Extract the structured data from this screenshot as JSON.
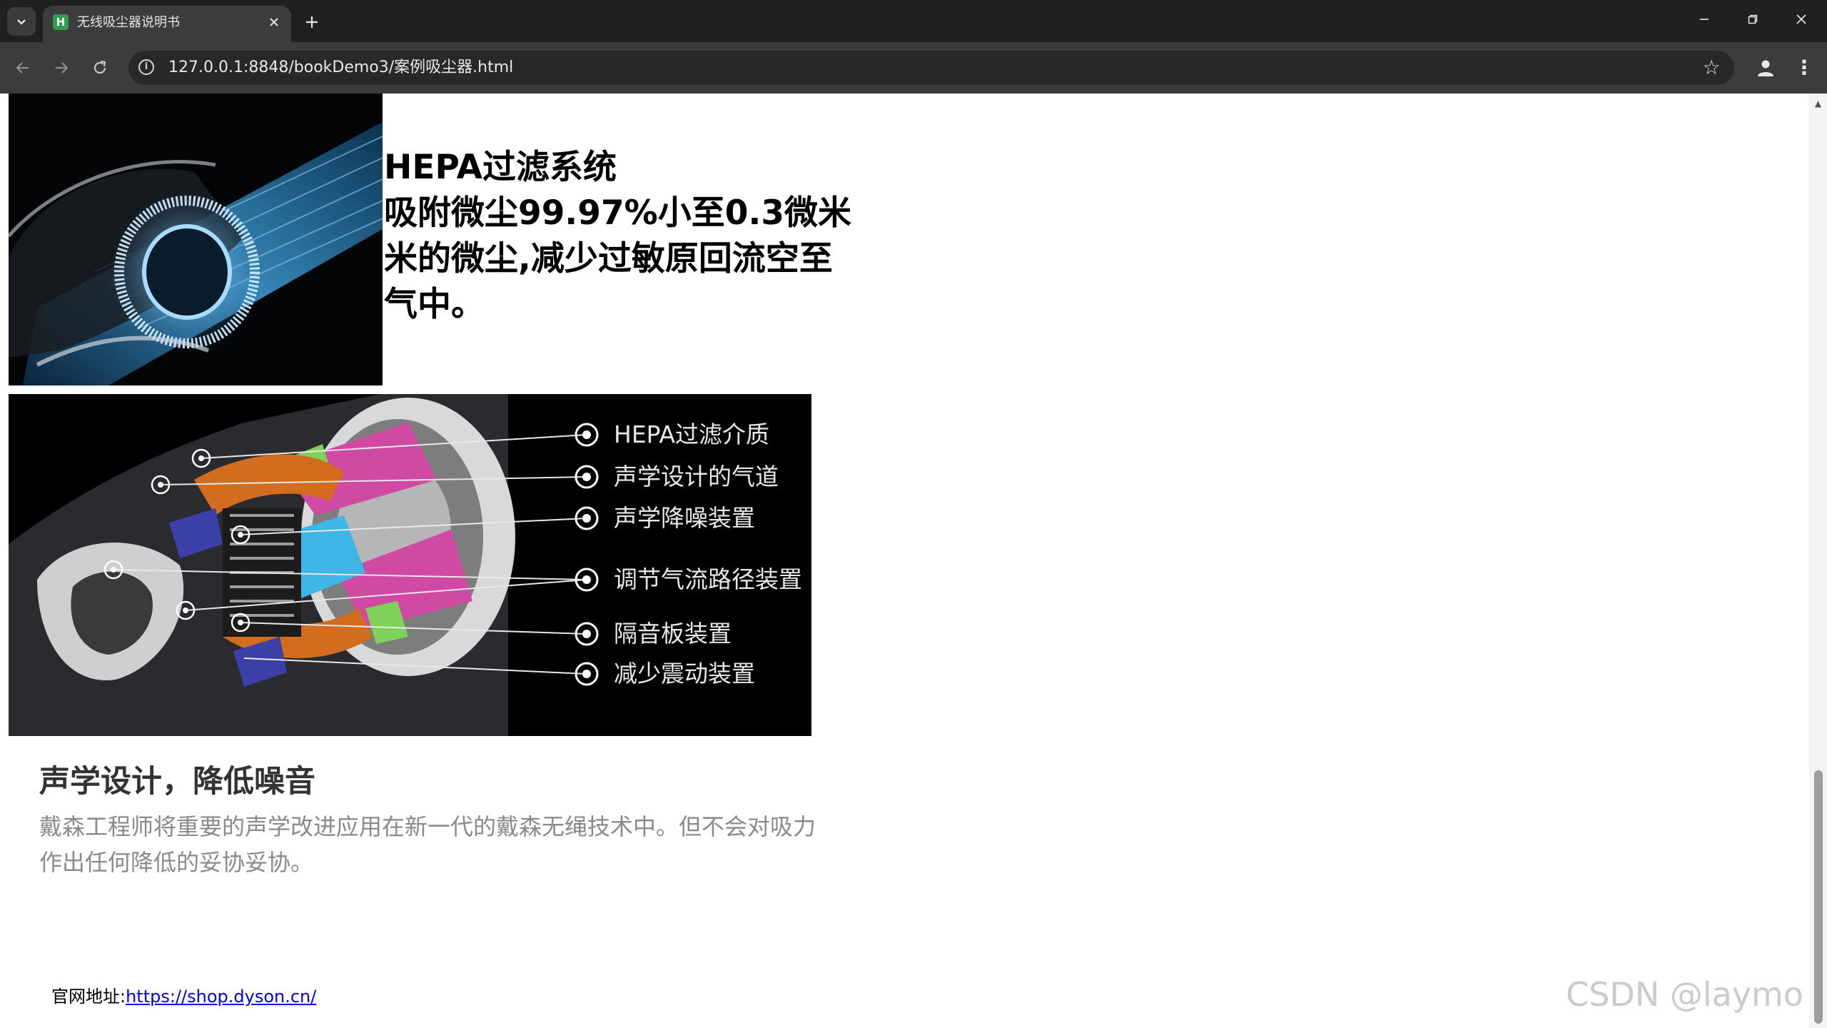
{
  "browser": {
    "tab_title": "无线吸尘器说明书",
    "tab_favicon_letter": "H",
    "url": "127.0.0.1:8848/bookDemo3/案例吸尘器.html",
    "icons": {
      "tab_menu": "chevron-down-icon",
      "close_tab": "close-icon",
      "new_tab": "plus-icon",
      "back": "arrow-left-icon",
      "forward": "arrow-right-icon",
      "reload": "reload-icon",
      "site_info": "info-icon",
      "bookmark": "star-icon",
      "profile": "person-icon",
      "menu": "kebab-menu-icon",
      "minimize": "minimize-icon",
      "restore": "restore-icon",
      "close_window": "close-icon"
    }
  },
  "page": {
    "hepa_lines": [
      "HEPA过滤系统",
      "吸附微尘99.97%小至0.3微米",
      "米的微尘,减少过敏原回流空至",
      "气中。"
    ],
    "cutaway_labels": [
      "HEPA过滤介质",
      "声学设计的气道",
      "声学降噪装置",
      "调节气流路径装置",
      "隔音板装置",
      "减少震动装置"
    ],
    "acoustic_title": "声学设计，降低噪音",
    "acoustic_desc": "戴森工程师将重要的声学改进应用在新一代的戴森无绳技术中。但不会对吸力作出任何降低的妥协妥协。",
    "footer_label": "官网地址:",
    "footer_link": "https://shop.dyson.cn/",
    "watermark": "CSDN @laymo"
  },
  "colors": {
    "tabstrip": "#1f2020",
    "toolbar": "#3c3c3c",
    "omnibox": "#282828",
    "link": "#0000ee",
    "desc_text": "#8a8a8a"
  }
}
